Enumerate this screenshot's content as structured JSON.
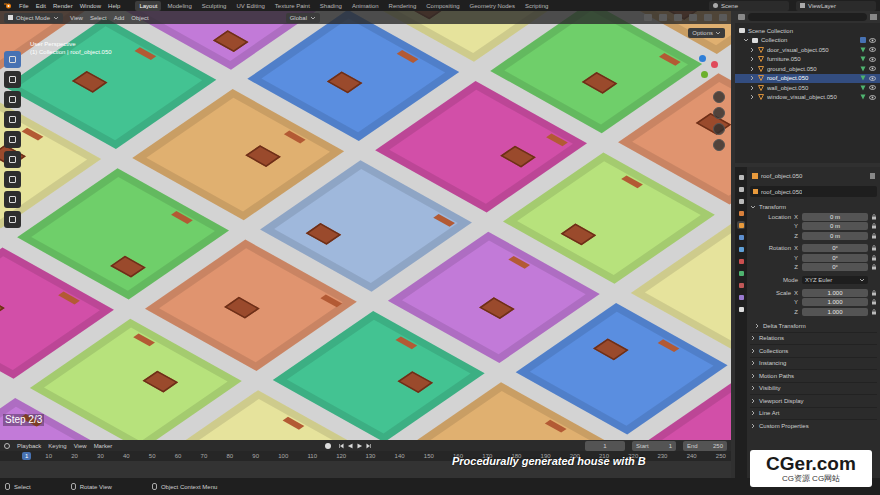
{
  "topbar": {
    "menus": [
      "File",
      "Edit",
      "Render",
      "Window",
      "Help"
    ],
    "workspaces": [
      {
        "label": "Layout",
        "selected": true
      },
      {
        "label": "Modeling",
        "selected": false
      },
      {
        "label": "Sculpting",
        "selected": false
      },
      {
        "label": "UV Editing",
        "selected": false
      },
      {
        "label": "Texture Paint",
        "selected": false
      },
      {
        "label": "Shading",
        "selected": false
      },
      {
        "label": "Animation",
        "selected": false
      },
      {
        "label": "Rendering",
        "selected": false
      },
      {
        "label": "Compositing",
        "selected": false
      },
      {
        "label": "Geometry Nodes",
        "selected": false
      },
      {
        "label": "Scripting",
        "selected": false
      }
    ],
    "scene": "Scene",
    "view_layer": "ViewLayer"
  },
  "viewport": {
    "mode": "Object Mode",
    "menus": [
      "View",
      "Select",
      "Add",
      "Object"
    ],
    "orientation": "Global",
    "options": "Options",
    "perspective": "User Perspective",
    "context": "(1) Collection | roof_object.050",
    "step": "Step 2/3"
  },
  "outliner": {
    "root": "Scene Collection",
    "collection": {
      "label": "Collection",
      "checked": true
    },
    "items": [
      {
        "label": "door_visual_object.050",
        "selected": false
      },
      {
        "label": "furniture.050",
        "selected": false
      },
      {
        "label": "ground_object.050",
        "selected": false
      },
      {
        "label": "roof_object.050",
        "selected": true
      },
      {
        "label": "wall_object.050",
        "selected": false
      },
      {
        "label": "window_visual_object.050",
        "selected": false
      }
    ]
  },
  "properties": {
    "header": "roof_object.050",
    "name": "roof_object.050",
    "transform": "Transform",
    "groups": [
      {
        "label": "Location",
        "rows": [
          {
            "axis": "X",
            "value": "0 m"
          },
          {
            "axis": "Y",
            "value": "0 m"
          },
          {
            "axis": "Z",
            "value": "0 m"
          }
        ]
      },
      {
        "label": "Rotation",
        "rows": [
          {
            "axis": "X",
            "value": "0°"
          },
          {
            "axis": "Y",
            "value": "0°"
          },
          {
            "axis": "Z",
            "value": "0°"
          }
        ]
      }
    ],
    "mode": {
      "label": "Mode",
      "value": "XYZ Euler"
    },
    "scale": {
      "label": "Scale",
      "rows": [
        {
          "axis": "X",
          "value": "1.000"
        },
        {
          "axis": "Y",
          "value": "1.000"
        },
        {
          "axis": "Z",
          "value": "1.000"
        }
      ]
    },
    "delta": "Delta Transform",
    "sections": [
      "Relations",
      "Collections",
      "Instancing",
      "Motion Paths",
      "Visibility",
      "Viewport Display",
      "Line Art",
      "Custom Properties"
    ]
  },
  "timeline": {
    "menus": [
      "Playback",
      "Keying",
      "View",
      "Marker"
    ],
    "frame": "1",
    "start_label": "Start",
    "start": "1",
    "end_label": "End",
    "end": "250",
    "current": "1",
    "ruler": [
      "10",
      "20",
      "30",
      "40",
      "50",
      "60",
      "70",
      "80",
      "90",
      "100",
      "110",
      "120",
      "130",
      "140",
      "150",
      "160",
      "170",
      "180",
      "190",
      "200",
      "210",
      "220",
      "230",
      "240",
      "250"
    ]
  },
  "status_bar": [
    "Select",
    "Rotate View",
    "Object Context Menu"
  ],
  "watermark": {
    "caption": "Procedurally generated house with B",
    "logo": "CGer.com",
    "logo_sub": "CG资源 CG网站"
  }
}
